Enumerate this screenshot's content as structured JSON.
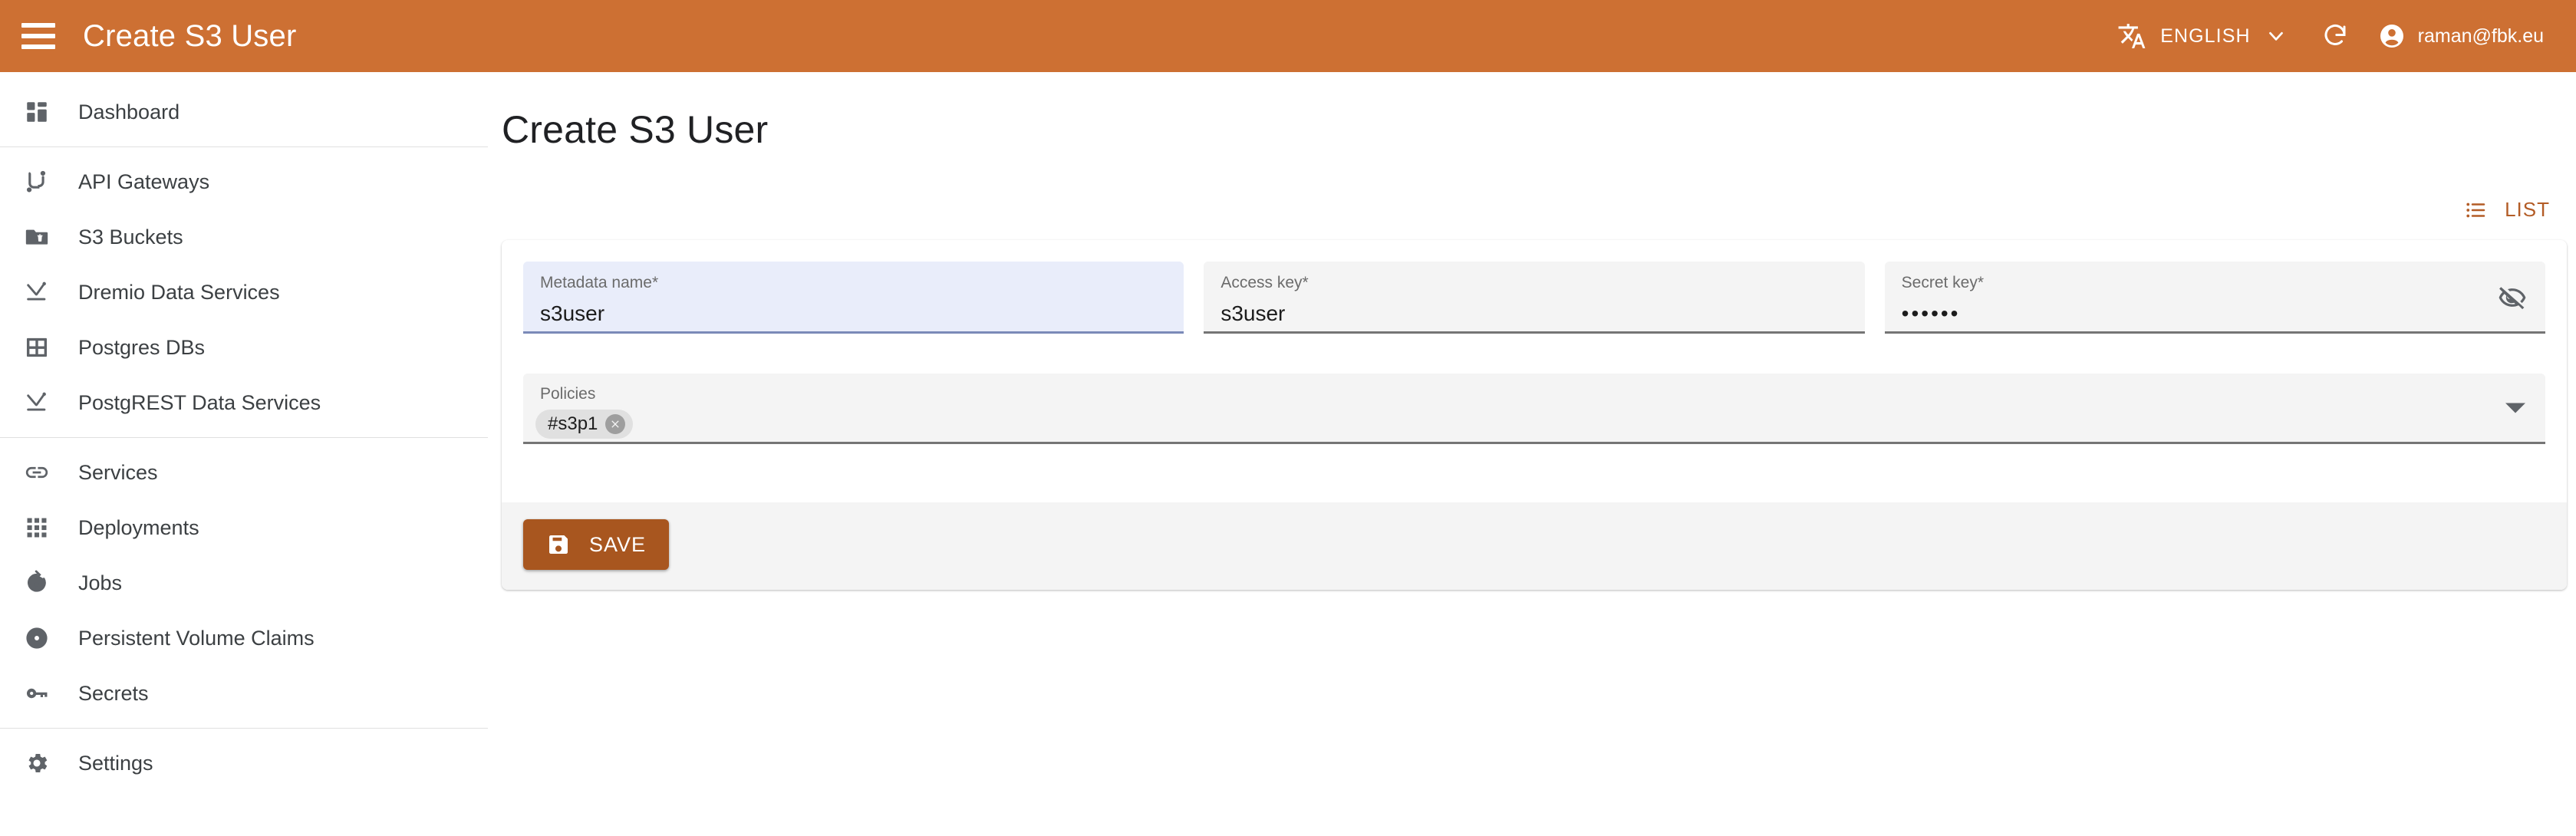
{
  "header": {
    "menu_icon": "hamburger-menu-icon",
    "title": "Create S3 User",
    "language_icon": "translate-icon",
    "language_label": "ENGLISH",
    "language_chevron_icon": "chevron-down-icon",
    "refresh_icon": "refresh-icon",
    "account_icon": "account-circle-icon",
    "account_email": "raman@fbk.eu",
    "background_color": "#CD7033"
  },
  "sidebar": {
    "groups": [
      {
        "items": [
          {
            "label": "Dashboard",
            "icon": "dashboard-icon"
          }
        ]
      },
      {
        "items": [
          {
            "label": "API Gateways",
            "icon": "api-gateway-icon"
          },
          {
            "label": "S3 Buckets",
            "icon": "bucket-folder-icon"
          },
          {
            "label": "Dremio Data Services",
            "icon": "data-service-icon"
          },
          {
            "label": "Postgres DBs",
            "icon": "table-grid-icon"
          },
          {
            "label": "PostgREST Data Services",
            "icon": "data-service-icon"
          }
        ]
      },
      {
        "items": [
          {
            "label": "Services",
            "icon": "link-icon"
          },
          {
            "label": "Deployments",
            "icon": "apps-grid-icon"
          },
          {
            "label": "Jobs",
            "icon": "job-rotate-icon"
          },
          {
            "label": "Persistent Volume Claims",
            "icon": "disc-icon"
          },
          {
            "label": "Secrets",
            "icon": "key-icon"
          }
        ]
      },
      {
        "items": [
          {
            "label": "Settings",
            "icon": "gear-icon"
          }
        ]
      }
    ]
  },
  "main": {
    "page_title": "Create S3 User",
    "list_button": {
      "label": "LIST",
      "icon": "list-icon",
      "color": "#B35C26"
    },
    "form": {
      "fields": [
        {
          "name": "metadata-name",
          "label": "Metadata name",
          "required_marker": "*",
          "value": "s3user",
          "placeholder": "",
          "focused": true
        },
        {
          "name": "access-key",
          "label": "Access key",
          "required_marker": "*",
          "value": "s3user",
          "placeholder": "",
          "focused": false
        },
        {
          "name": "secret-key",
          "label": "Secret key",
          "required_marker": "*",
          "value": "••••••",
          "placeholder": "",
          "focused": false,
          "visibility_icon": "visibility-off-icon"
        }
      ],
      "policies": {
        "label": "Policies",
        "chips": [
          {
            "label": "#s3p1",
            "remove_icon": "close-icon"
          }
        ],
        "dropdown_icon": "dropdown-arrow-icon"
      },
      "save_button": {
        "label": "SAVE",
        "icon": "save-floppy-icon",
        "color": "#A8561F"
      }
    }
  }
}
